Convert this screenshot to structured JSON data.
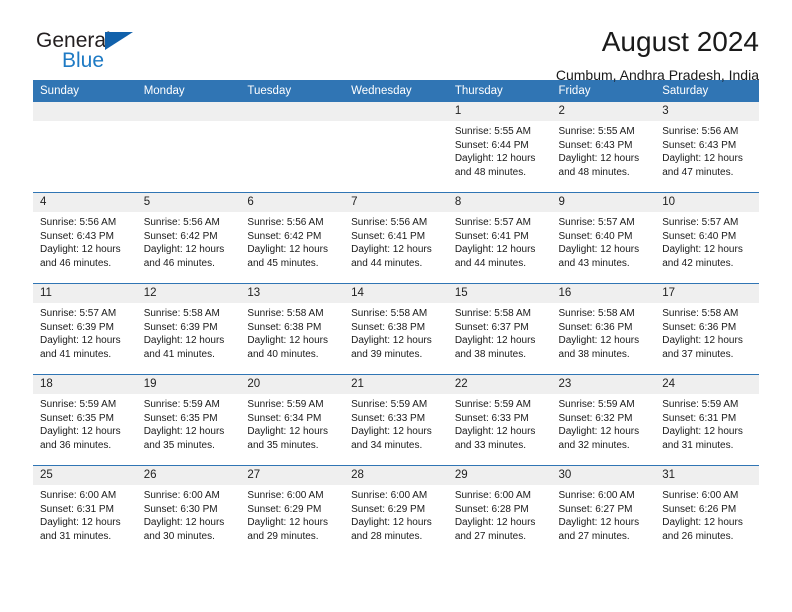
{
  "brand": {
    "name_part1": "General",
    "name_part2": "Blue",
    "triangle_color": "#1161ab",
    "blue_color": "#1e7ac4"
  },
  "header": {
    "title": "August 2024",
    "subtitle": "Cumbum, Andhra Pradesh, India"
  },
  "theme": {
    "header_bg": "#3075b4",
    "daynum_bg": "#efefef",
    "divider": "#3075b4"
  },
  "weekdays": [
    "Sunday",
    "Monday",
    "Tuesday",
    "Wednesday",
    "Thursday",
    "Friday",
    "Saturday"
  ],
  "labels": {
    "sunrise_prefix": "Sunrise:",
    "sunset_prefix": "Sunset:",
    "daylight_prefix": "Daylight:"
  },
  "weeks": [
    [
      {
        "day": "",
        "empty": true
      },
      {
        "day": "",
        "empty": true
      },
      {
        "day": "",
        "empty": true
      },
      {
        "day": "",
        "empty": true
      },
      {
        "day": "1",
        "sunrise": "Sunrise: 5:55 AM",
        "sunset": "Sunset: 6:44 PM",
        "daylight_l1": "Daylight: 12 hours",
        "daylight_l2": "and 48 minutes."
      },
      {
        "day": "2",
        "sunrise": "Sunrise: 5:55 AM",
        "sunset": "Sunset: 6:43 PM",
        "daylight_l1": "Daylight: 12 hours",
        "daylight_l2": "and 48 minutes."
      },
      {
        "day": "3",
        "sunrise": "Sunrise: 5:56 AM",
        "sunset": "Sunset: 6:43 PM",
        "daylight_l1": "Daylight: 12 hours",
        "daylight_l2": "and 47 minutes."
      }
    ],
    [
      {
        "day": "4",
        "sunrise": "Sunrise: 5:56 AM",
        "sunset": "Sunset: 6:43 PM",
        "daylight_l1": "Daylight: 12 hours",
        "daylight_l2": "and 46 minutes."
      },
      {
        "day": "5",
        "sunrise": "Sunrise: 5:56 AM",
        "sunset": "Sunset: 6:42 PM",
        "daylight_l1": "Daylight: 12 hours",
        "daylight_l2": "and 46 minutes."
      },
      {
        "day": "6",
        "sunrise": "Sunrise: 5:56 AM",
        "sunset": "Sunset: 6:42 PM",
        "daylight_l1": "Daylight: 12 hours",
        "daylight_l2": "and 45 minutes."
      },
      {
        "day": "7",
        "sunrise": "Sunrise: 5:56 AM",
        "sunset": "Sunset: 6:41 PM",
        "daylight_l1": "Daylight: 12 hours",
        "daylight_l2": "and 44 minutes."
      },
      {
        "day": "8",
        "sunrise": "Sunrise: 5:57 AM",
        "sunset": "Sunset: 6:41 PM",
        "daylight_l1": "Daylight: 12 hours",
        "daylight_l2": "and 44 minutes."
      },
      {
        "day": "9",
        "sunrise": "Sunrise: 5:57 AM",
        "sunset": "Sunset: 6:40 PM",
        "daylight_l1": "Daylight: 12 hours",
        "daylight_l2": "and 43 minutes."
      },
      {
        "day": "10",
        "sunrise": "Sunrise: 5:57 AM",
        "sunset": "Sunset: 6:40 PM",
        "daylight_l1": "Daylight: 12 hours",
        "daylight_l2": "and 42 minutes."
      }
    ],
    [
      {
        "day": "11",
        "sunrise": "Sunrise: 5:57 AM",
        "sunset": "Sunset: 6:39 PM",
        "daylight_l1": "Daylight: 12 hours",
        "daylight_l2": "and 41 minutes."
      },
      {
        "day": "12",
        "sunrise": "Sunrise: 5:58 AM",
        "sunset": "Sunset: 6:39 PM",
        "daylight_l1": "Daylight: 12 hours",
        "daylight_l2": "and 41 minutes."
      },
      {
        "day": "13",
        "sunrise": "Sunrise: 5:58 AM",
        "sunset": "Sunset: 6:38 PM",
        "daylight_l1": "Daylight: 12 hours",
        "daylight_l2": "and 40 minutes."
      },
      {
        "day": "14",
        "sunrise": "Sunrise: 5:58 AM",
        "sunset": "Sunset: 6:38 PM",
        "daylight_l1": "Daylight: 12 hours",
        "daylight_l2": "and 39 minutes."
      },
      {
        "day": "15",
        "sunrise": "Sunrise: 5:58 AM",
        "sunset": "Sunset: 6:37 PM",
        "daylight_l1": "Daylight: 12 hours",
        "daylight_l2": "and 38 minutes."
      },
      {
        "day": "16",
        "sunrise": "Sunrise: 5:58 AM",
        "sunset": "Sunset: 6:36 PM",
        "daylight_l1": "Daylight: 12 hours",
        "daylight_l2": "and 38 minutes."
      },
      {
        "day": "17",
        "sunrise": "Sunrise: 5:58 AM",
        "sunset": "Sunset: 6:36 PM",
        "daylight_l1": "Daylight: 12 hours",
        "daylight_l2": "and 37 minutes."
      }
    ],
    [
      {
        "day": "18",
        "sunrise": "Sunrise: 5:59 AM",
        "sunset": "Sunset: 6:35 PM",
        "daylight_l1": "Daylight: 12 hours",
        "daylight_l2": "and 36 minutes."
      },
      {
        "day": "19",
        "sunrise": "Sunrise: 5:59 AM",
        "sunset": "Sunset: 6:35 PM",
        "daylight_l1": "Daylight: 12 hours",
        "daylight_l2": "and 35 minutes."
      },
      {
        "day": "20",
        "sunrise": "Sunrise: 5:59 AM",
        "sunset": "Sunset: 6:34 PM",
        "daylight_l1": "Daylight: 12 hours",
        "daylight_l2": "and 35 minutes."
      },
      {
        "day": "21",
        "sunrise": "Sunrise: 5:59 AM",
        "sunset": "Sunset: 6:33 PM",
        "daylight_l1": "Daylight: 12 hours",
        "daylight_l2": "and 34 minutes."
      },
      {
        "day": "22",
        "sunrise": "Sunrise: 5:59 AM",
        "sunset": "Sunset: 6:33 PM",
        "daylight_l1": "Daylight: 12 hours",
        "daylight_l2": "and 33 minutes."
      },
      {
        "day": "23",
        "sunrise": "Sunrise: 5:59 AM",
        "sunset": "Sunset: 6:32 PM",
        "daylight_l1": "Daylight: 12 hours",
        "daylight_l2": "and 32 minutes."
      },
      {
        "day": "24",
        "sunrise": "Sunrise: 5:59 AM",
        "sunset": "Sunset: 6:31 PM",
        "daylight_l1": "Daylight: 12 hours",
        "daylight_l2": "and 31 minutes."
      }
    ],
    [
      {
        "day": "25",
        "sunrise": "Sunrise: 6:00 AM",
        "sunset": "Sunset: 6:31 PM",
        "daylight_l1": "Daylight: 12 hours",
        "daylight_l2": "and 31 minutes."
      },
      {
        "day": "26",
        "sunrise": "Sunrise: 6:00 AM",
        "sunset": "Sunset: 6:30 PM",
        "daylight_l1": "Daylight: 12 hours",
        "daylight_l2": "and 30 minutes."
      },
      {
        "day": "27",
        "sunrise": "Sunrise: 6:00 AM",
        "sunset": "Sunset: 6:29 PM",
        "daylight_l1": "Daylight: 12 hours",
        "daylight_l2": "and 29 minutes."
      },
      {
        "day": "28",
        "sunrise": "Sunrise: 6:00 AM",
        "sunset": "Sunset: 6:29 PM",
        "daylight_l1": "Daylight: 12 hours",
        "daylight_l2": "and 28 minutes."
      },
      {
        "day": "29",
        "sunrise": "Sunrise: 6:00 AM",
        "sunset": "Sunset: 6:28 PM",
        "daylight_l1": "Daylight: 12 hours",
        "daylight_l2": "and 27 minutes."
      },
      {
        "day": "30",
        "sunrise": "Sunrise: 6:00 AM",
        "sunset": "Sunset: 6:27 PM",
        "daylight_l1": "Daylight: 12 hours",
        "daylight_l2": "and 27 minutes."
      },
      {
        "day": "31",
        "sunrise": "Sunrise: 6:00 AM",
        "sunset": "Sunset: 6:26 PM",
        "daylight_l1": "Daylight: 12 hours",
        "daylight_l2": "and 26 minutes."
      }
    ]
  ]
}
